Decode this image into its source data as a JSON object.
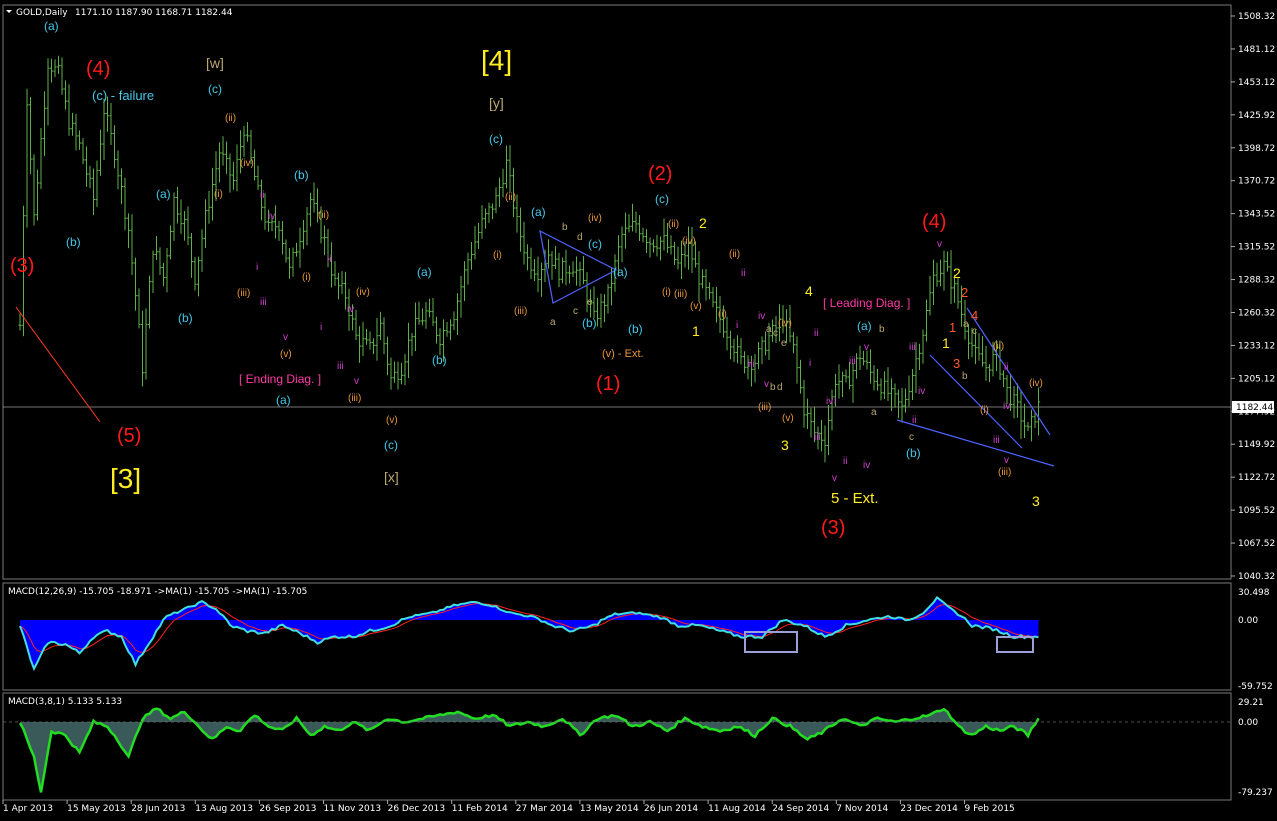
{
  "header": {
    "symbol": "GOLD,Daily",
    "ohlc": "1171.10 1187.90 1168.71 1182.44",
    "current_price": "1182.44"
  },
  "colors": {
    "background": "#000000",
    "bars": "#5fb04a",
    "macd_fill": "#0000ff",
    "macd_line": "#40e0e0",
    "signal_line": "#ff2020",
    "osc_fill": "#3a5a5a",
    "osc_line": "#22dd22",
    "grid": "#6a6a6a",
    "trend_line": "#4f63ff"
  },
  "price_axis": {
    "ticks": [
      "1508.32",
      "1481.12",
      "1453.12",
      "1425.92",
      "1398.72",
      "1370.72",
      "1343.52",
      "1315.52",
      "1288.32",
      "1260.32",
      "1233.12",
      "1205.12",
      "1177.92",
      "1149.92",
      "1122.72",
      "1095.52",
      "1067.52",
      "1040.32"
    ]
  },
  "macd_axis": {
    "ticks": [
      "30.498",
      "0.00",
      "-59.752"
    ]
  },
  "osc_axis": {
    "ticks": [
      "29.21",
      "0.00",
      "-79.237"
    ]
  },
  "time_axis": {
    "ticks": [
      "1 Apr 2013",
      "15 May 2013",
      "28 Jun 2013",
      "13 Aug 2013",
      "26 Sep 2013",
      "11 Nov 2013",
      "26 Dec 2013",
      "11 Feb 2014",
      "27 Mar 2014",
      "13 May 2014",
      "26 Jun 2014",
      "11 Aug 2014",
      "24 Sep 2014",
      "7 Nov 2014",
      "23 Dec 2014",
      "9 Feb 2015"
    ]
  },
  "indicators": {
    "macd_title": "MACD(12,26,9) -15.705 -18.971  ->MA(1) -15.705 ->MA(1) -15.705",
    "osc_title": "MACD(3,8,1) 5.133 5.133"
  },
  "labels": {
    "l_3_a": "(3)",
    "l_4_a": "(4)",
    "l_5_a": "(5)",
    "l_br3": "[3]",
    "l_a1": "(a)",
    "l_cfail": "(c) - failure",
    "l_b1": "(b)",
    "l_a2": "(a)",
    "l_b2": "(b)",
    "l_w": "[w]",
    "l_c1": "(c)",
    "l_ii1": "(ii)",
    "l_i1": "(i)",
    "l_iv1": "(iv)",
    "l_iii1": "(iii)",
    "l_v1": "(v)",
    "l_b3": "(b)",
    "l_ii2": "(ii)",
    "l_i2": "(i)",
    "l_iv2": "(iv)",
    "l_iii2": "(iii)",
    "l_v2": "(v)",
    "l_ed": "[ Ending Diag. ]",
    "l_a3": "(a)",
    "l_m_ii1": "ii",
    "l_m_iv1": "iv",
    "l_m_i1": "i",
    "l_m_iii1": "iii",
    "l_m_v1": "v",
    "l_m_ii2": "ii",
    "l_m_iv2": "iv",
    "l_m_i2": "i",
    "l_m_iii2": "iii",
    "l_m_v2": "v",
    "l_c2": "(c)",
    "l_x": "[x]",
    "l_a4": "(a)",
    "l_b4": "(b)",
    "l_br4": "[4]",
    "l_y": "[y]",
    "l_c3": "(c)",
    "l_ii3": "(ii)",
    "l_i3": "(i)",
    "l_iii3": "(iii)",
    "l_iv3": "(iv)",
    "l_c4": "(c)",
    "l_a5": "(a)",
    "l_b5": "(b)",
    "l_b6": "(b)",
    "l_a6": "(a)",
    "l_vext": "(v) - Ext.",
    "l_ta": "a",
    "l_tb": "b",
    "l_tc": "c",
    "l_td": "d",
    "l_te": "e",
    "l_1r": "(1)",
    "l_2r": "(2)",
    "l_c5": "(c)",
    "l_ii4": "(ii)",
    "l_iv4": "(iv)",
    "l_i4": "(i)",
    "l_iii4": "(iii)",
    "l_v3": "(v)",
    "l_y1": "1",
    "l_y2": "2",
    "l_ii5": "(ii)",
    "l_m_ii3": "ii",
    "l_i5": "(i)",
    "l_m_i3": "i",
    "l_m_iv3": "iv",
    "l_s_a": "a",
    "l_s_c": "c",
    "l_s_e": "e",
    "l_iv5": "(iv)",
    "l_m_iii3": "iii",
    "l_m_v3": "v",
    "l_s_b": "b",
    "l_s_d": "d",
    "l_iii5": "(iii)",
    "l_v4": "(v)",
    "l_y3": "3",
    "l_y4": "4",
    "l_m_ii4": "ii",
    "l_m_i4": "i",
    "l_ld": "[ Leading Diag. ]",
    "l_m_iv4": "iv",
    "l_m_i5": "i",
    "l_m_iii4": "iii",
    "l_m_ii5": "ii",
    "l_m_v4": "v",
    "l_5ext": "5 - Ext.",
    "l_3r": "(3)",
    "l_m_iv5": "iv",
    "l_a7": "(a)",
    "l_m_v5": "v",
    "l_m_iii5": "iii",
    "l_s_a2": "a",
    "l_s_b2": "b",
    "l_m_ii6": "ii",
    "l_s_c2": "c",
    "l_b7": "(b)",
    "l_m_iii6": "iii",
    "l_m_iv6": "iv",
    "l_4r": "(4)",
    "l_m_v6": "v",
    "l_y5": "2",
    "l_o2": "2",
    "l_o4": "4",
    "l_s_a3": "a",
    "l_s_c3": "c",
    "l_o1": "1",
    "l_y6": "1",
    "l_o3": "3",
    "l_s_b3": "b",
    "l_ii6": "(ii)",
    "l_m_ii7": "ii",
    "l_i6": "(i)",
    "l_m_iv7": "iv",
    "l_m_iii7": "iii",
    "l_m_v7": "v",
    "l_iii6": "(iii)",
    "l_iv6": "(iv)",
    "l_y7": "3"
  },
  "chart_data": {
    "type": "candlestick",
    "title": "GOLD,Daily",
    "x_range": [
      "1 Apr 2013",
      "Mar 2015"
    ],
    "ylim": [
      1040.32,
      1508.32
    ],
    "current_price": 1182.44,
    "grid": false,
    "price_anchors": [
      [
        0,
        1250
      ],
      [
        2,
        1440
      ],
      [
        4,
        1340
      ],
      [
        8,
        1470
      ],
      [
        11,
        1460
      ],
      [
        14,
        1420
      ],
      [
        17,
        1400
      ],
      [
        21,
        1355
      ],
      [
        24,
        1430
      ],
      [
        27,
        1395
      ],
      [
        31,
        1330
      ],
      [
        33,
        1275
      ],
      [
        35,
        1215
      ],
      [
        38,
        1315
      ],
      [
        41,
        1290
      ],
      [
        44,
        1355
      ],
      [
        47,
        1335
      ],
      [
        50,
        1290
      ],
      [
        53,
        1340
      ],
      [
        57,
        1395
      ],
      [
        61,
        1370
      ],
      [
        64,
        1415
      ],
      [
        68,
        1360
      ],
      [
        71,
        1330
      ],
      [
        74,
        1335
      ],
      [
        77,
        1295
      ],
      [
        80,
        1325
      ],
      [
        83,
        1355
      ],
      [
        87,
        1320
      ],
      [
        90,
        1285
      ],
      [
        93,
        1275
      ],
      [
        96,
        1240
      ],
      [
        100,
        1230
      ],
      [
        103,
        1250
      ],
      [
        106,
        1205
      ],
      [
        109,
        1215
      ],
      [
        112,
        1245
      ],
      [
        116,
        1260
      ],
      [
        120,
        1240
      ],
      [
        124,
        1260
      ],
      [
        128,
        1305
      ],
      [
        132,
        1335
      ],
      [
        136,
        1355
      ],
      [
        139,
        1385
      ],
      [
        142,
        1335
      ],
      [
        145,
        1305
      ],
      [
        148,
        1295
      ],
      [
        151,
        1310
      ],
      [
        154,
        1295
      ],
      [
        158,
        1300
      ],
      [
        161,
        1285
      ],
      [
        164,
        1255
      ],
      [
        168,
        1275
      ],
      [
        172,
        1325
      ],
      [
        176,
        1335
      ],
      [
        180,
        1320
      ],
      [
        184,
        1320
      ],
      [
        188,
        1300
      ],
      [
        191,
        1315
      ],
      [
        194,
        1290
      ],
      [
        198,
        1265
      ],
      [
        202,
        1245
      ],
      [
        206,
        1220
      ],
      [
        210,
        1220
      ],
      [
        214,
        1240
      ],
      [
        218,
        1255
      ],
      [
        221,
        1230
      ],
      [
        224,
        1180
      ],
      [
        227,
        1160
      ],
      [
        230,
        1155
      ],
      [
        233,
        1205
      ],
      [
        236,
        1200
      ],
      [
        240,
        1225
      ],
      [
        243,
        1210
      ],
      [
        246,
        1200
      ],
      [
        249,
        1190
      ],
      [
        252,
        1180
      ],
      [
        255,
        1210
      ],
      [
        258,
        1245
      ],
      [
        261,
        1290
      ],
      [
        264,
        1300
      ],
      [
        267,
        1280
      ],
      [
        270,
        1250
      ],
      [
        273,
        1225
      ],
      [
        276,
        1215
      ],
      [
        279,
        1225
      ],
      [
        282,
        1195
      ],
      [
        285,
        1180
      ],
      [
        288,
        1160
      ],
      [
        291,
        1182
      ]
    ],
    "macd_anchors": [
      [
        0,
        -5
      ],
      [
        4,
        -45
      ],
      [
        8,
        -20
      ],
      [
        13,
        -22
      ],
      [
        17,
        -30
      ],
      [
        21,
        -15
      ],
      [
        25,
        -10
      ],
      [
        29,
        -15
      ],
      [
        33,
        -40
      ],
      [
        37,
        -20
      ],
      [
        42,
        5
      ],
      [
        47,
        15
      ],
      [
        52,
        25
      ],
      [
        56,
        15
      ],
      [
        60,
        -5
      ],
      [
        65,
        -10
      ],
      [
        70,
        -12
      ],
      [
        75,
        -5
      ],
      [
        80,
        -12
      ],
      [
        85,
        -20
      ],
      [
        90,
        -15
      ],
      [
        95,
        -15
      ],
      [
        100,
        -10
      ],
      [
        106,
        -5
      ],
      [
        112,
        5
      ],
      [
        118,
        10
      ],
      [
        124,
        20
      ],
      [
        130,
        25
      ],
      [
        135,
        20
      ],
      [
        140,
        10
      ],
      [
        146,
        5
      ],
      [
        152,
        -5
      ],
      [
        158,
        -10
      ],
      [
        164,
        -5
      ],
      [
        170,
        8
      ],
      [
        176,
        10
      ],
      [
        182,
        5
      ],
      [
        188,
        -5
      ],
      [
        194,
        -5
      ],
      [
        200,
        -10
      ],
      [
        206,
        -15
      ],
      [
        212,
        -15
      ],
      [
        218,
        0
      ],
      [
        224,
        -5
      ],
      [
        230,
        -15
      ],
      [
        236,
        -5
      ],
      [
        242,
        0
      ],
      [
        248,
        5
      ],
      [
        254,
        0
      ],
      [
        258,
        10
      ],
      [
        262,
        30
      ],
      [
        266,
        15
      ],
      [
        272,
        -5
      ],
      [
        278,
        -8
      ],
      [
        284,
        -15
      ],
      [
        291,
        -15
      ]
    ],
    "osc_anchors": [
      [
        0,
        0
      ],
      [
        4,
        -40
      ],
      [
        6,
        -79
      ],
      [
        9,
        -10
      ],
      [
        13,
        -15
      ],
      [
        17,
        -35
      ],
      [
        21,
        0
      ],
      [
        25,
        -5
      ],
      [
        28,
        -20
      ],
      [
        31,
        -40
      ],
      [
        35,
        5
      ],
      [
        39,
        20
      ],
      [
        43,
        5
      ],
      [
        47,
        15
      ],
      [
        51,
        -5
      ],
      [
        55,
        -20
      ],
      [
        59,
        -5
      ],
      [
        63,
        -10
      ],
      [
        67,
        10
      ],
      [
        71,
        -5
      ],
      [
        75,
        -10
      ],
      [
        79,
        5
      ],
      [
        83,
        -15
      ],
      [
        87,
        -5
      ],
      [
        91,
        -10
      ],
      [
        95,
        0
      ],
      [
        100,
        -10
      ],
      [
        105,
        5
      ],
      [
        110,
        0
      ],
      [
        115,
        5
      ],
      [
        120,
        10
      ],
      [
        125,
        15
      ],
      [
        130,
        5
      ],
      [
        135,
        10
      ],
      [
        140,
        -5
      ],
      [
        145,
        0
      ],
      [
        150,
        -5
      ],
      [
        155,
        5
      ],
      [
        160,
        -15
      ],
      [
        165,
        5
      ],
      [
        170,
        10
      ],
      [
        175,
        -5
      ],
      [
        180,
        0
      ],
      [
        185,
        -10
      ],
      [
        190,
        5
      ],
      [
        195,
        -5
      ],
      [
        200,
        -10
      ],
      [
        205,
        -5
      ],
      [
        210,
        -15
      ],
      [
        215,
        5
      ],
      [
        220,
        -5
      ],
      [
        225,
        -20
      ],
      [
        230,
        -10
      ],
      [
        235,
        5
      ],
      [
        240,
        -5
      ],
      [
        245,
        5
      ],
      [
        250,
        0
      ],
      [
        255,
        5
      ],
      [
        260,
        10
      ],
      [
        264,
        20
      ],
      [
        268,
        -5
      ],
      [
        272,
        -15
      ],
      [
        276,
        -5
      ],
      [
        280,
        -10
      ],
      [
        284,
        -5
      ],
      [
        288,
        -15
      ],
      [
        291,
        5
      ]
    ]
  }
}
